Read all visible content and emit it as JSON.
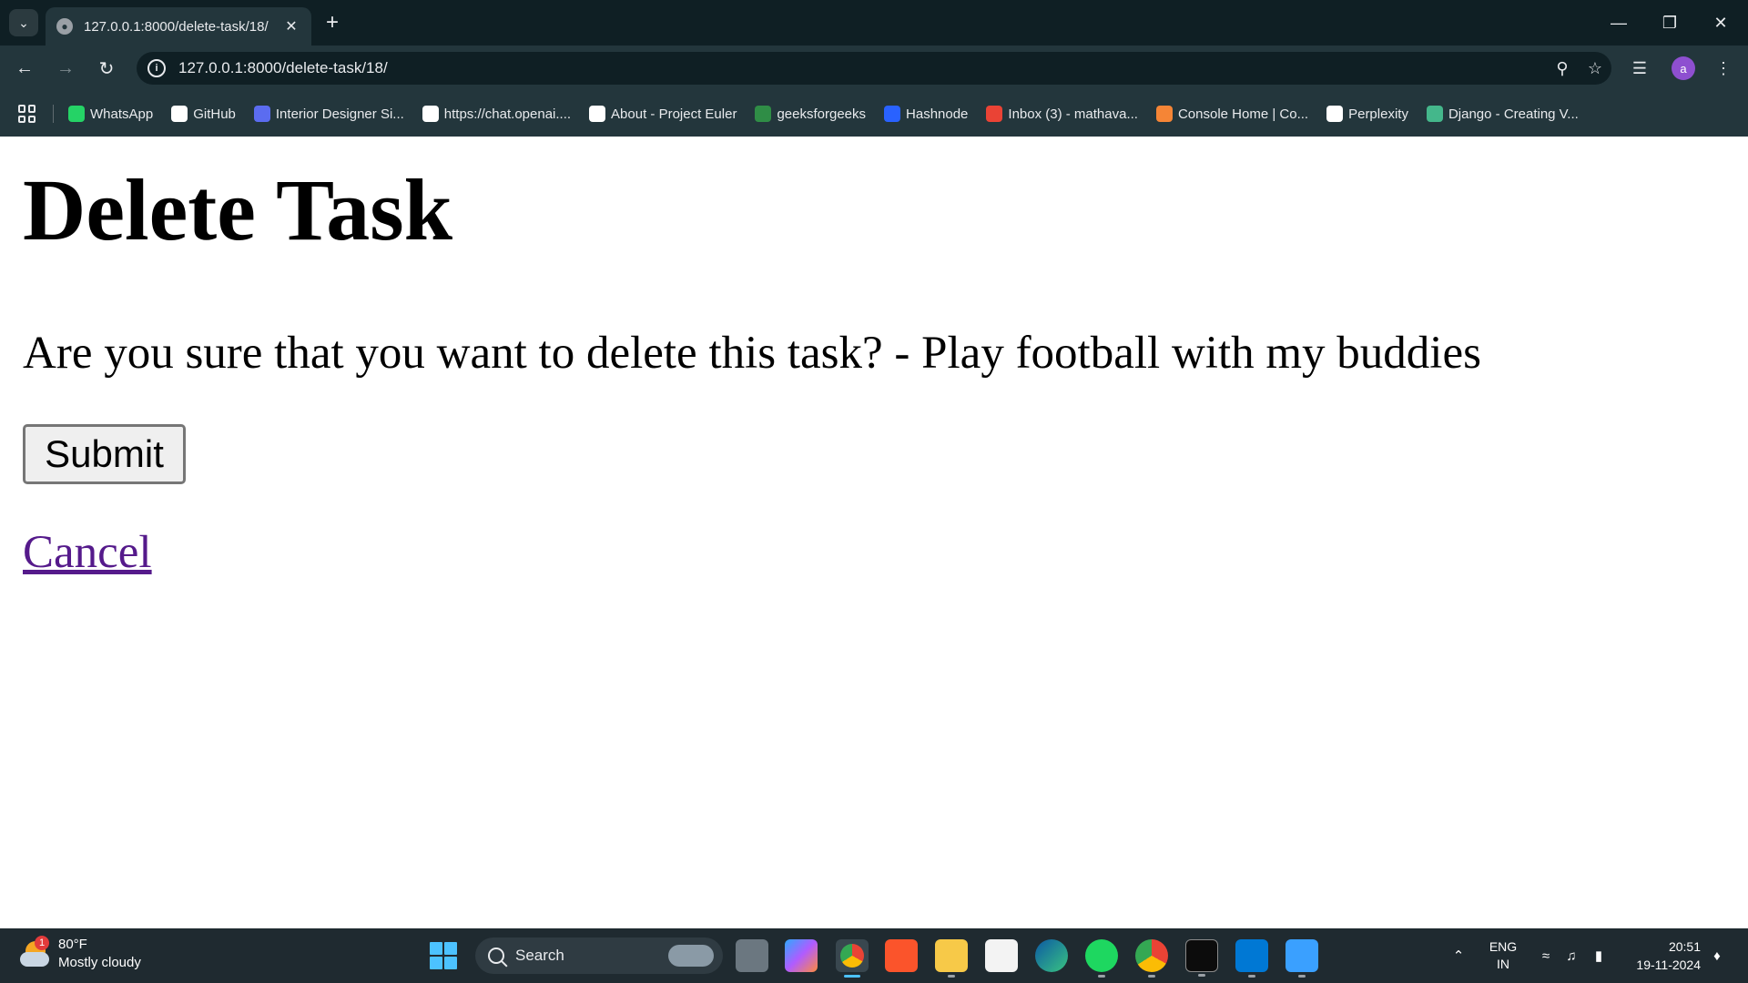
{
  "browser": {
    "tab": {
      "title": "127.0.0.1:8000/delete-task/18/"
    },
    "url": "127.0.0.1:8000/delete-task/18/",
    "profile_initial": "a",
    "bookmarks": [
      {
        "label": "WhatsApp",
        "icon": "whatsapp-icon",
        "color": "#25d366"
      },
      {
        "label": "GitHub",
        "icon": "github-icon",
        "color": "#ffffff"
      },
      {
        "label": "Interior Designer Si...",
        "icon": "designer-icon",
        "color": "#5b6cf0"
      },
      {
        "label": "https://chat.openai....",
        "icon": "openai-icon",
        "color": "#ffffff"
      },
      {
        "label": "About - Project Euler",
        "icon": "project-euler-icon",
        "color": "#ffffff"
      },
      {
        "label": "geeksforgeeks",
        "icon": "geeksforgeeks-icon",
        "color": "#2f8d46"
      },
      {
        "label": "Hashnode",
        "icon": "hashnode-icon",
        "color": "#2962ff"
      },
      {
        "label": "Inbox (3) - mathava...",
        "icon": "gmail-icon",
        "color": "#ea4335"
      },
      {
        "label": "Console Home | Co...",
        "icon": "aws-console-icon",
        "color": "#f58536"
      },
      {
        "label": "Perplexity",
        "icon": "perplexity-icon",
        "color": "#ffffff"
      },
      {
        "label": "Django - Creating V...",
        "icon": "django-icon",
        "color": "#44b78b"
      }
    ]
  },
  "page": {
    "heading": "Delete Task",
    "question": "Are you sure that you want to delete this task? - Play football with my buddies",
    "submit_label": "Submit",
    "cancel_label": "Cancel"
  },
  "taskbar": {
    "weather": {
      "temp": "80°F",
      "condition": "Mostly cloudy",
      "badge": "1"
    },
    "search_label": "Search",
    "language": {
      "line1": "ENG",
      "line2": "IN"
    },
    "clock": {
      "time": "20:51",
      "date": "19-11-2024"
    }
  }
}
